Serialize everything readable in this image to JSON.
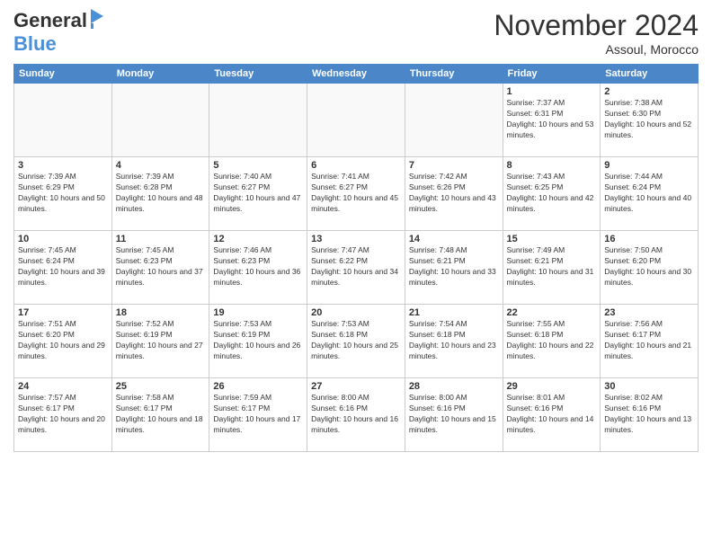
{
  "header": {
    "logo_general": "General",
    "logo_blue": "Blue",
    "title": "November 2024",
    "location": "Assoul, Morocco"
  },
  "days_of_week": [
    "Sunday",
    "Monday",
    "Tuesday",
    "Wednesday",
    "Thursday",
    "Friday",
    "Saturday"
  ],
  "weeks": [
    [
      {
        "day": "",
        "empty": true
      },
      {
        "day": "",
        "empty": true
      },
      {
        "day": "",
        "empty": true
      },
      {
        "day": "",
        "empty": true
      },
      {
        "day": "",
        "empty": true
      },
      {
        "day": "1",
        "sunrise": "7:37 AM",
        "sunset": "6:31 PM",
        "daylight": "10 hours and 53 minutes."
      },
      {
        "day": "2",
        "sunrise": "7:38 AM",
        "sunset": "6:30 PM",
        "daylight": "10 hours and 52 minutes."
      }
    ],
    [
      {
        "day": "3",
        "sunrise": "7:39 AM",
        "sunset": "6:29 PM",
        "daylight": "10 hours and 50 minutes."
      },
      {
        "day": "4",
        "sunrise": "7:39 AM",
        "sunset": "6:28 PM",
        "daylight": "10 hours and 48 minutes."
      },
      {
        "day": "5",
        "sunrise": "7:40 AM",
        "sunset": "6:27 PM",
        "daylight": "10 hours and 47 minutes."
      },
      {
        "day": "6",
        "sunrise": "7:41 AM",
        "sunset": "6:27 PM",
        "daylight": "10 hours and 45 minutes."
      },
      {
        "day": "7",
        "sunrise": "7:42 AM",
        "sunset": "6:26 PM",
        "daylight": "10 hours and 43 minutes."
      },
      {
        "day": "8",
        "sunrise": "7:43 AM",
        "sunset": "6:25 PM",
        "daylight": "10 hours and 42 minutes."
      },
      {
        "day": "9",
        "sunrise": "7:44 AM",
        "sunset": "6:24 PM",
        "daylight": "10 hours and 40 minutes."
      }
    ],
    [
      {
        "day": "10",
        "sunrise": "7:45 AM",
        "sunset": "6:24 PM",
        "daylight": "10 hours and 39 minutes."
      },
      {
        "day": "11",
        "sunrise": "7:45 AM",
        "sunset": "6:23 PM",
        "daylight": "10 hours and 37 minutes."
      },
      {
        "day": "12",
        "sunrise": "7:46 AM",
        "sunset": "6:23 PM",
        "daylight": "10 hours and 36 minutes."
      },
      {
        "day": "13",
        "sunrise": "7:47 AM",
        "sunset": "6:22 PM",
        "daylight": "10 hours and 34 minutes."
      },
      {
        "day": "14",
        "sunrise": "7:48 AM",
        "sunset": "6:21 PM",
        "daylight": "10 hours and 33 minutes."
      },
      {
        "day": "15",
        "sunrise": "7:49 AM",
        "sunset": "6:21 PM",
        "daylight": "10 hours and 31 minutes."
      },
      {
        "day": "16",
        "sunrise": "7:50 AM",
        "sunset": "6:20 PM",
        "daylight": "10 hours and 30 minutes."
      }
    ],
    [
      {
        "day": "17",
        "sunrise": "7:51 AM",
        "sunset": "6:20 PM",
        "daylight": "10 hours and 29 minutes."
      },
      {
        "day": "18",
        "sunrise": "7:52 AM",
        "sunset": "6:19 PM",
        "daylight": "10 hours and 27 minutes."
      },
      {
        "day": "19",
        "sunrise": "7:53 AM",
        "sunset": "6:19 PM",
        "daylight": "10 hours and 26 minutes."
      },
      {
        "day": "20",
        "sunrise": "7:53 AM",
        "sunset": "6:18 PM",
        "daylight": "10 hours and 25 minutes."
      },
      {
        "day": "21",
        "sunrise": "7:54 AM",
        "sunset": "6:18 PM",
        "daylight": "10 hours and 23 minutes."
      },
      {
        "day": "22",
        "sunrise": "7:55 AM",
        "sunset": "6:18 PM",
        "daylight": "10 hours and 22 minutes."
      },
      {
        "day": "23",
        "sunrise": "7:56 AM",
        "sunset": "6:17 PM",
        "daylight": "10 hours and 21 minutes."
      }
    ],
    [
      {
        "day": "24",
        "sunrise": "7:57 AM",
        "sunset": "6:17 PM",
        "daylight": "10 hours and 20 minutes."
      },
      {
        "day": "25",
        "sunrise": "7:58 AM",
        "sunset": "6:17 PM",
        "daylight": "10 hours and 18 minutes."
      },
      {
        "day": "26",
        "sunrise": "7:59 AM",
        "sunset": "6:17 PM",
        "daylight": "10 hours and 17 minutes."
      },
      {
        "day": "27",
        "sunrise": "8:00 AM",
        "sunset": "6:16 PM",
        "daylight": "10 hours and 16 minutes."
      },
      {
        "day": "28",
        "sunrise": "8:00 AM",
        "sunset": "6:16 PM",
        "daylight": "10 hours and 15 minutes."
      },
      {
        "day": "29",
        "sunrise": "8:01 AM",
        "sunset": "6:16 PM",
        "daylight": "10 hours and 14 minutes."
      },
      {
        "day": "30",
        "sunrise": "8:02 AM",
        "sunset": "6:16 PM",
        "daylight": "10 hours and 13 minutes."
      }
    ]
  ],
  "labels": {
    "sunrise_label": "Sunrise:",
    "sunset_label": "Sunset:",
    "daylight_label": "Daylight:"
  }
}
